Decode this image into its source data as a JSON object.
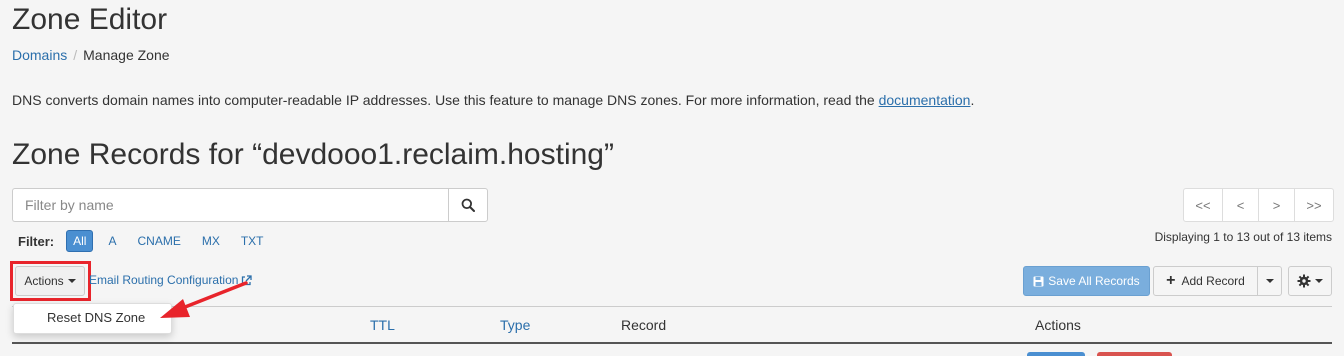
{
  "page": {
    "title": "Zone Editor"
  },
  "breadcrumb": {
    "items": [
      "Domains",
      "Manage Zone"
    ]
  },
  "description": {
    "text": "DNS converts domain names into computer-readable IP addresses. Use this feature to manage DNS zones. For more information, read the ",
    "link_label": "documentation",
    "suffix": "."
  },
  "zone": {
    "heading": "Zone Records for “devdooo1.reclaim.hosting”"
  },
  "search": {
    "placeholder": "Filter by name",
    "icon": "search-icon"
  },
  "filter": {
    "label": "Filter:",
    "options": [
      "All",
      "A",
      "CNAME",
      "MX",
      "TXT"
    ],
    "selected": "All"
  },
  "pagination": {
    "buttons": [
      "<<",
      "<",
      ">",
      ">>"
    ]
  },
  "displaying_text": "Displaying 1 to 13 out of 13 items",
  "toolbar": {
    "actions_label": "Actions",
    "email_routing_label": "Email Routing Configuration",
    "save_all_label": "Save All Records",
    "add_record_label": "Add Record"
  },
  "actions_menu": {
    "items": [
      "Reset DNS Zone"
    ]
  },
  "table": {
    "columns": [
      "TTL",
      "Type",
      "Record",
      "Actions"
    ]
  },
  "colors": {
    "link": "#2b6fab",
    "highlight": "#e8242b",
    "primary": "#4a8fd1",
    "danger": "#d9534f"
  }
}
